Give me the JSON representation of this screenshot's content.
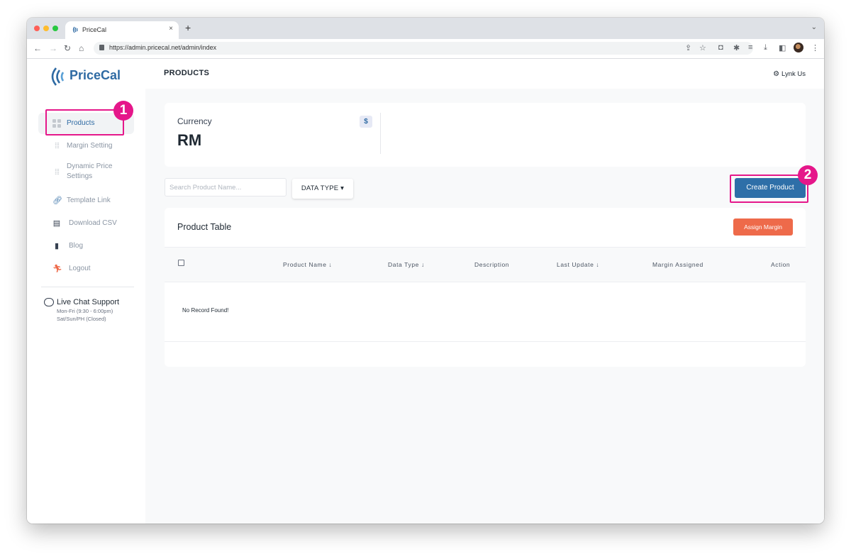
{
  "browser": {
    "tab_title": "PriceCal",
    "tab_close": "×",
    "new_tab": "+",
    "url": "https://admin.pricecal.net/admin/index"
  },
  "sidebar": {
    "brand": "PriceCal",
    "items": [
      {
        "label": "Products",
        "icon": "grid-icon"
      },
      {
        "label": "Margin Setting",
        "icon": "sliders-icon"
      },
      {
        "label": "Dynamic Price Settings",
        "icon": "sliders-icon"
      },
      {
        "label": "Template Link",
        "icon": "link-icon"
      },
      {
        "label": "Download CSV",
        "icon": "file-icon"
      },
      {
        "label": "Blog",
        "icon": "book-icon"
      },
      {
        "label": "Logout",
        "icon": "run-icon"
      }
    ],
    "dynamic_line1": "Dynamic Price",
    "dynamic_line2": "Settings",
    "chat": {
      "title": "Live Chat Support",
      "hours_weekday": "Mon-Fri (9:30 - 6:00pm)",
      "hours_weekend": "Sat/Sun/PH (Closed)"
    }
  },
  "header": {
    "title": "PRODUCTS",
    "contact": "Lynk Us"
  },
  "currency": {
    "label": "Currency",
    "value": "RM",
    "badge": "$"
  },
  "controls": {
    "search_placeholder": "Search Product Name...",
    "data_type": "DATA TYPE ▾",
    "create": "Create Product"
  },
  "table": {
    "title": "Product Table",
    "assign": "Assign Margin",
    "columns": [
      "Product Name ↓",
      "Data Type ↓",
      "Description",
      "Last Update ↓",
      "Margin Assigned",
      "Action"
    ],
    "empty": "No Record Found!"
  },
  "annotations": [
    "1",
    "2"
  ],
  "colors": {
    "brand": "#2e6aa3",
    "primary_button": "#2e6fa8",
    "assign_button": "#ee6a4a",
    "highlight": "#e5178a"
  }
}
